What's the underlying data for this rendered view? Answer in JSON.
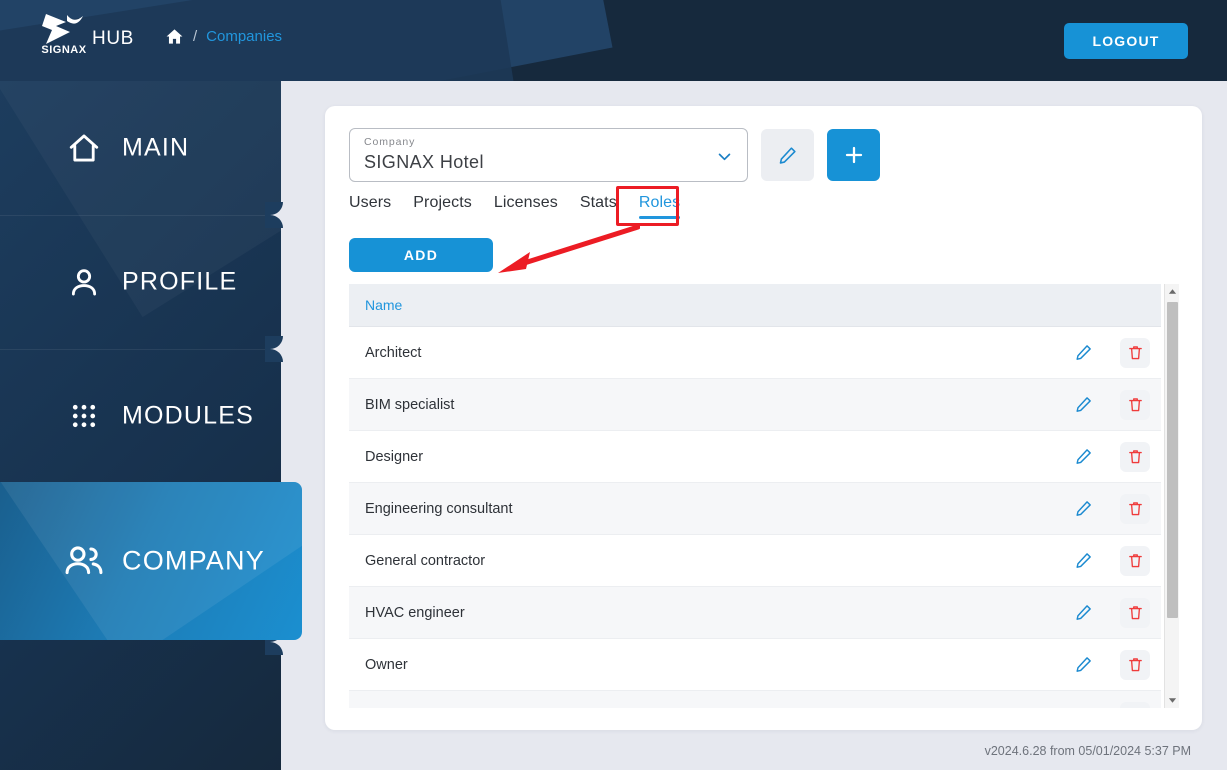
{
  "header": {
    "logo_text": "SIGNAX",
    "logo_icon": "signax-logo-icon",
    "app_name": "HUB",
    "breadcrumb": {
      "home_icon": "home-icon",
      "separator": "/",
      "current": "Companies"
    },
    "logout_label": "LOGOUT"
  },
  "sidebar": {
    "items": [
      {
        "label": "MAIN",
        "icon": "home-icon",
        "active": false
      },
      {
        "label": "PROFILE",
        "icon": "person-icon",
        "active": false
      },
      {
        "label": "MODULES",
        "icon": "grid-dots-icon",
        "active": false
      },
      {
        "label": "COMPANY",
        "icon": "people-group-icon",
        "active": true
      }
    ]
  },
  "main": {
    "company_select": {
      "label": "Company",
      "value": "SIGNAX Hotel",
      "chevron_icon": "chevron-down-icon"
    },
    "edit_company_button": {
      "icon": "pencil-icon"
    },
    "add_company_button": {
      "icon": "plus-icon",
      "label": "+"
    },
    "tabs": [
      {
        "label": "Users",
        "active": false
      },
      {
        "label": "Projects",
        "active": false
      },
      {
        "label": "Licenses",
        "active": false
      },
      {
        "label": "Stats",
        "active": false
      },
      {
        "label": "Roles",
        "active": true
      }
    ],
    "add_button_label": "ADD",
    "table": {
      "columns": [
        "Name",
        "",
        ""
      ],
      "rows": [
        {
          "name": "Architect"
        },
        {
          "name": "BIM specialist"
        },
        {
          "name": "Designer"
        },
        {
          "name": "Engineering consultant"
        },
        {
          "name": "General contractor"
        },
        {
          "name": "HVAC engineer"
        },
        {
          "name": "Owner"
        },
        {
          "name": ""
        }
      ],
      "row_edit_icon": "pencil-icon",
      "row_delete_icon": "trash-icon",
      "scrollbar": {
        "up_icon": "caret-up-icon",
        "down_icon": "caret-down-icon"
      }
    }
  },
  "annotations": {
    "highlight_target": "Roles",
    "arrow_from": "Roles tab",
    "arrow_to": "ADD button",
    "color": "#ec1c24"
  },
  "footer": {
    "version_text": "v2024.6.28 from 05/01/2024 5:37 PM"
  },
  "colors": {
    "header_bg": "#16293d",
    "sidebar_bg": "#1d3d5e",
    "accent_blue": "#1792d6",
    "link_blue": "#2196dd",
    "page_bg": "#e6e8ef",
    "danger_red": "#ec1c24"
  }
}
